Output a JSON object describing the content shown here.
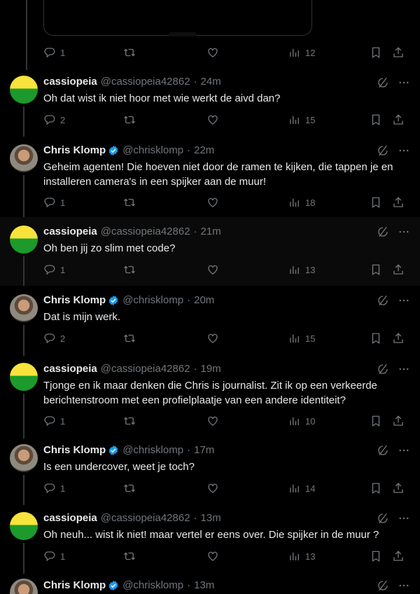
{
  "posts": [
    {
      "id": "p0",
      "reply_count": "1",
      "view_count": "12"
    },
    {
      "id": "p1",
      "name": "cassiopeia",
      "handle": "@cassiopeia42862",
      "time": "24m",
      "text": "Oh dat wist ik niet hoor met wie werkt de aivd dan?",
      "reply_count": "2",
      "view_count": "15"
    },
    {
      "id": "p2",
      "name": "Chris Klomp",
      "handle": "@chrisklomp",
      "time": "22m",
      "text": "Geheim agenten! Die hoeven niet door de ramen te kijken, die tappen je en installeren camera's in een spijker aan de muur!",
      "reply_count": "1",
      "view_count": "18"
    },
    {
      "id": "p3",
      "name": "cassiopeia",
      "handle": "@cassiopeia42862",
      "time": "21m",
      "text": "Oh ben jij zo slim met code?",
      "reply_count": "1",
      "view_count": "13"
    },
    {
      "id": "p4",
      "name": "Chris Klomp",
      "handle": "@chrisklomp",
      "time": "20m",
      "text": "Dat is mijn werk.",
      "reply_count": "2",
      "view_count": "15"
    },
    {
      "id": "p5",
      "name": "cassiopeia",
      "handle": "@cassiopeia42862",
      "time": "19m",
      "text": "Tjonge en ik maar denken die Chris is journalist. Zit ik op een verkeerde berichtenstroom met een profielplaatje van een andere identiteit?",
      "reply_count": "1",
      "view_count": "10"
    },
    {
      "id": "p6",
      "name": "Chris Klomp",
      "handle": "@chrisklomp",
      "time": "17m",
      "text": "Is een undercover, weet je toch?",
      "reply_count": "1",
      "view_count": "14"
    },
    {
      "id": "p7",
      "name": "cassiopeia",
      "handle": "@cassiopeia42862",
      "time": "13m",
      "text": "Oh neuh... wist ik niet! maar vertel er eens over. Die spijker in de muur ?",
      "reply_count": "1",
      "view_count": "13"
    },
    {
      "id": "p8",
      "name": "Chris Klomp",
      "handle": "@chrisklomp",
      "time": "13m"
    }
  ],
  "separator": "·",
  "colors": {
    "background": "#000000",
    "text": "#e7e9ea",
    "muted": "#71767b",
    "verified": "#1d9bf0",
    "highlight": "#0a0a0a"
  }
}
